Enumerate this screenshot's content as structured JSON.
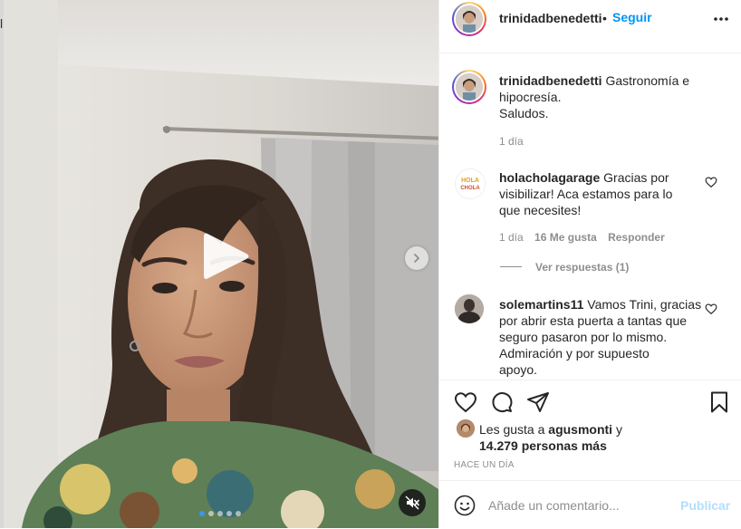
{
  "edge": {
    "glyph": "l"
  },
  "post": {
    "author": "trinidadbenedetti",
    "separator": "•",
    "follow_label": "Seguir",
    "more_icon": "more-horizontal-icon",
    "carousel": {
      "slides": 5,
      "active_index": 0
    }
  },
  "caption": {
    "username": "trinidadbenedetti",
    "line1": "Gastronomía e",
    "line2": "hipocresía.",
    "line3": "Saludos.",
    "time": "1 día"
  },
  "comments": [
    {
      "username": "holacholagarage",
      "line1": "Gracias por",
      "line2": "visibilizar! Aca estamos para lo",
      "line3": "que necesites!",
      "time": "1 día",
      "likes": "16 Me gusta",
      "reply_label": "Responder",
      "view_replies": "Ver respuestas (1)",
      "avatar_text_1": "HOLA",
      "avatar_text_2": "CHOLA"
    },
    {
      "username": "solemartins11",
      "line1": "Vamos Trini, gracias",
      "line2": "por abrir esta puerta a tantas que",
      "line3": "seguro pasaron por lo mismo.",
      "line4": "Admiración y por supuesto",
      "line5": "apoyo."
    }
  ],
  "likes": {
    "prefix": "Les gusta a",
    "user": "agusmonti",
    "conj": "y",
    "others": "14.279 personas más"
  },
  "date": "HACE UN DÍA",
  "add_comment": {
    "placeholder": "Añade un comentario...",
    "publish_label": "Publicar"
  },
  "colors": {
    "accent": "#0095f6",
    "publish_disabled": "#b2dffc",
    "muted_text": "#8e8e8e"
  }
}
